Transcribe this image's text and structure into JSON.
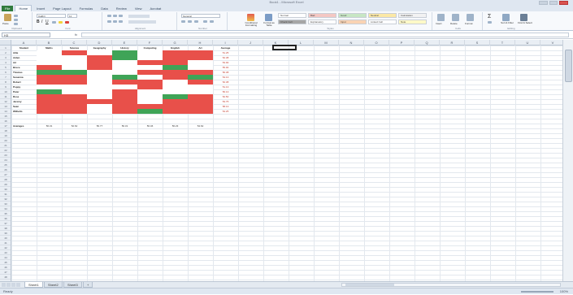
{
  "titlebar": {
    "title": "Book1 - Microsoft Excel"
  },
  "ribbon": {
    "tabs": [
      "File",
      "Home",
      "Insert",
      "Page Layout",
      "Formulas",
      "Data",
      "Review",
      "View",
      "Acrobat"
    ],
    "active_tab": "Home",
    "groups": [
      "Clipboard",
      "Font",
      "Alignment",
      "Number",
      "Styles",
      "Cells",
      "Editing"
    ],
    "font_name": "Calibri",
    "font_size": "11",
    "number_format": "General",
    "buttons": {
      "paste": "Paste",
      "conditional_formatting": "Conditional Formatting",
      "format_as_table": "Format as Table",
      "insert": "Insert",
      "delete": "Delete",
      "format": "Format",
      "sort_filter": "Sort & Filter",
      "find_select": "Find & Select"
    },
    "styles": [
      {
        "label": "Normal",
        "bg": "#ffffff"
      },
      {
        "label": "Bad",
        "bg": "#f4c7c3"
      },
      {
        "label": "Good",
        "bg": "#c7e6c4"
      },
      {
        "label": "Neutral",
        "bg": "#fbe8a6"
      },
      {
        "label": "Calculation",
        "bg": "#f2f2f2"
      },
      {
        "label": "Check Cell",
        "bg": "#a6a6a6"
      },
      {
        "label": "Explanatory",
        "bg": "#ffffff"
      },
      {
        "label": "Input",
        "bg": "#f9d3b3"
      },
      {
        "label": "Linked Cell",
        "bg": "#ffffff"
      },
      {
        "label": "Note",
        "bg": "#fff9c7"
      }
    ]
  },
  "formula_bar": {
    "name_box": "H3",
    "fx": "fx",
    "formula": ""
  },
  "grid": {
    "columns": [
      "A",
      "B",
      "C",
      "D",
      "E",
      "F",
      "G",
      "H",
      "I",
      "J",
      "K",
      "L",
      "M",
      "N",
      "O",
      "P",
      "Q",
      "R",
      "S",
      "T",
      "U",
      "V"
    ],
    "row_count": 48,
    "headers": [
      "Student",
      "Maths",
      "Science",
      "Geography",
      "History",
      "Computing",
      "English",
      "Art",
      "Average"
    ],
    "students": [
      "Ailie",
      "Aiden",
      "Ari",
      "Bruce",
      "Thomas",
      "Susanna",
      "Robert",
      "Poppy",
      "Peter",
      "Rose",
      "Jeremy",
      "Sean",
      "Wilhelm"
    ],
    "averages": [
      "51.25",
      "52.38",
      "53.00",
      "55.00",
      "50.38",
      "54.13",
      "52.38",
      "51.13",
      "56.13",
      "52.50",
      "53.75",
      "58.13",
      "54.25"
    ],
    "bottom_label": "Averages",
    "bottom_values": [
      "56.31",
      "52.62",
      "56.77",
      "56.31",
      "56.46",
      "56.23",
      "54.62"
    ],
    "heat_colors": {
      "red": "#e8504a",
      "light_red": "#f08a83",
      "white": "#ffffff",
      "green": "#3fa457"
    },
    "heat_pattern": [
      [
        "W",
        "R",
        "W",
        "G",
        "W",
        "R",
        "R"
      ],
      [
        "W",
        "W",
        "R",
        "G",
        "W",
        "R",
        "R"
      ],
      [
        "W",
        "W",
        "R",
        "W",
        "R",
        "R",
        "W"
      ],
      [
        "R",
        "W",
        "R",
        "W",
        "W",
        "G",
        "W"
      ],
      [
        "G",
        "G",
        "W",
        "W",
        "R",
        "R",
        "R"
      ],
      [
        "R",
        "R",
        "W",
        "G",
        "W",
        "R",
        "G"
      ],
      [
        "R",
        "R",
        "W",
        "R",
        "R",
        "W",
        "R"
      ],
      [
        "W",
        "W",
        "W",
        "W",
        "R",
        "W",
        "W"
      ],
      [
        "G",
        "W",
        "W",
        "R",
        "W",
        "W",
        "W"
      ],
      [
        "R",
        "R",
        "W",
        "R",
        "W",
        "G",
        "R"
      ],
      [
        "R",
        "R",
        "R",
        "R",
        "W",
        "R",
        "R"
      ],
      [
        "R",
        "R",
        "W",
        "R",
        "R",
        "R",
        "R"
      ],
      [
        "R",
        "R",
        "W",
        "R",
        "G",
        "R",
        "R"
      ]
    ]
  },
  "sheets": {
    "tabs": [
      "Sheet1",
      "Sheet2",
      "Sheet3"
    ],
    "active": "Sheet1"
  },
  "status": {
    "ready": "Ready",
    "zoom": "100%"
  }
}
